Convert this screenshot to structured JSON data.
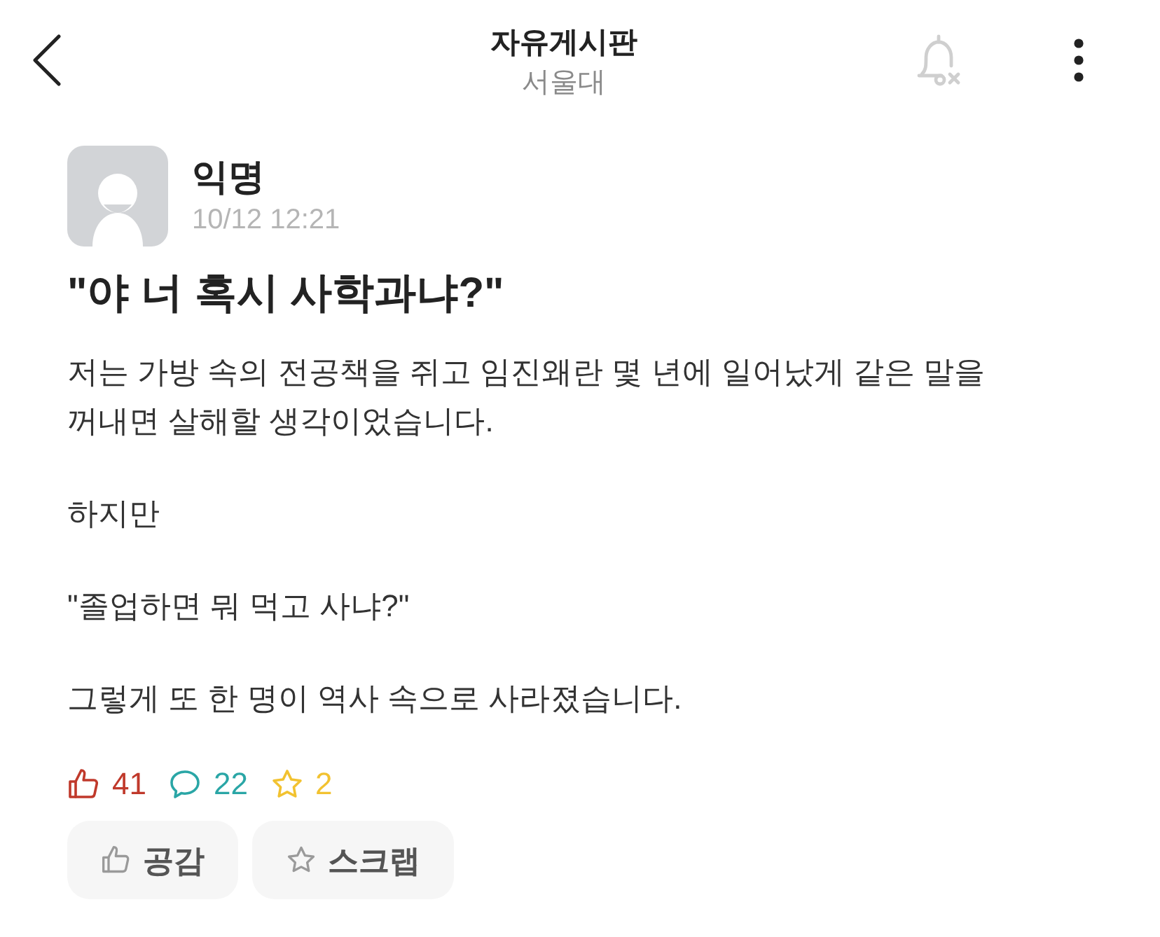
{
  "header": {
    "title": "자유게시판",
    "subtitle": "서울대"
  },
  "post": {
    "author": "익명",
    "time": "10/12 12:21",
    "title": "\"야 너 혹시 사학과냐?\"",
    "paragraphs": [
      "저는 가방 속의 전공책을 쥐고 임진왜란 몇 년에 일어났게 같은 말을 꺼내면 살해할 생각이었습니다.",
      "하지만",
      "\"졸업하면 뭐 먹고 사냐?\"",
      "그렇게 또 한 명이 역사 속으로 사라졌습니다."
    ]
  },
  "stats": [
    {
      "kind": "likes",
      "value": "41",
      "color": "#c0392b"
    },
    {
      "kind": "comments",
      "value": "22",
      "color": "#2aa6a6"
    },
    {
      "kind": "scraps",
      "value": "2",
      "color": "#f2c230"
    }
  ],
  "actions": [
    {
      "kind": "like",
      "label": "공감"
    },
    {
      "kind": "scrap",
      "label": "스크랩"
    }
  ]
}
